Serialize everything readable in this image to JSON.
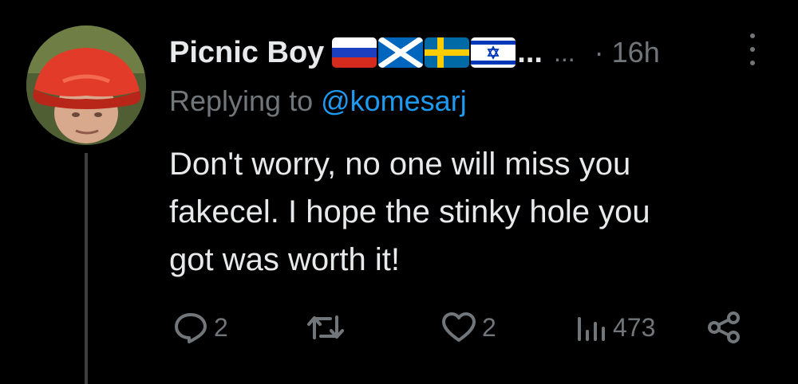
{
  "tweet": {
    "author_name": "Picnic Boy",
    "flags": [
      {
        "icon": "russia-flag-icon",
        "colors": [
          "#ffffff",
          "#1c3fc0",
          "#d52b1e"
        ]
      },
      {
        "icon": "scotland-flag-icon",
        "colors": [
          "#0065bd",
          "#ffffff"
        ]
      },
      {
        "icon": "sweden-flag-icon",
        "colors": [
          "#006aa7",
          "#fecc00"
        ]
      },
      {
        "icon": "israel-flag-icon",
        "colors": [
          "#ffffff",
          "#0038b8"
        ]
      }
    ],
    "name_overflow": "...",
    "more_dots": "...",
    "timestamp": "· 16h",
    "replying_prefix": "Replying to ",
    "replying_handle": "@komesarj",
    "text_lines": [
      "Don't worry, no one will miss you",
      "fakecel. I hope the stinky hole you",
      "got was worth it!"
    ]
  },
  "actions": {
    "reply": {
      "icon": "reply-icon",
      "count": "2"
    },
    "retweet": {
      "icon": "retweet-icon",
      "count": ""
    },
    "like": {
      "icon": "heart-icon",
      "count": "2"
    },
    "views": {
      "icon": "views-icon",
      "count": "473"
    },
    "share": {
      "icon": "share-icon"
    }
  },
  "colors": {
    "background": "#000000",
    "text": "#e7e9ea",
    "muted": "#71767b",
    "link": "#1d9bf0"
  }
}
